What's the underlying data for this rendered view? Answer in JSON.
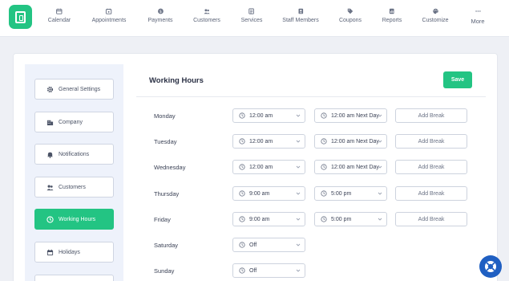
{
  "nav": {
    "items": [
      {
        "label": "Calendar",
        "icon": "calendar-icon"
      },
      {
        "label": "Appointments",
        "icon": "appointments-icon"
      },
      {
        "label": "Payments",
        "icon": "payments-icon"
      },
      {
        "label": "Customers",
        "icon": "customers-icon"
      },
      {
        "label": "Services",
        "icon": "services-icon"
      },
      {
        "label": "Staff Members",
        "icon": "staff-icon"
      },
      {
        "label": "Coupons",
        "icon": "coupon-icon"
      },
      {
        "label": "Reports",
        "icon": "reports-icon"
      },
      {
        "label": "Customize",
        "icon": "palette-icon"
      },
      {
        "label": "More",
        "icon": "more-icon"
      }
    ]
  },
  "sidebar": {
    "items": [
      {
        "label": "General Settings",
        "icon": "gear-icon"
      },
      {
        "label": "Company",
        "icon": "building-icon"
      },
      {
        "label": "Notifications",
        "icon": "bell-icon"
      },
      {
        "label": "Customers",
        "icon": "customers-icon"
      },
      {
        "label": "Working Hours",
        "icon": "clock-icon",
        "active": true
      },
      {
        "label": "Holidays",
        "icon": "calendar-icon"
      }
    ]
  },
  "main": {
    "title": "Working Hours",
    "save_label": "Save",
    "add_break_label": "Add Break",
    "days": [
      {
        "day": "Monday",
        "from": "12:00 am",
        "to": "12:00 am Next Day"
      },
      {
        "day": "Tuesday",
        "from": "12:00 am",
        "to": "12:00 am Next Day"
      },
      {
        "day": "Wednesday",
        "from": "12:00 am",
        "to": "12:00 am Next Day"
      },
      {
        "day": "Thursday",
        "from": "9:00 am",
        "to": "5:00 pm"
      },
      {
        "day": "Friday",
        "from": "9:00 am",
        "to": "5:00 pm"
      },
      {
        "day": "Saturday",
        "from": "Off"
      },
      {
        "day": "Sunday",
        "from": "Off"
      }
    ]
  },
  "colors": {
    "accent": "#23c483",
    "help": "#1f5fc2"
  }
}
